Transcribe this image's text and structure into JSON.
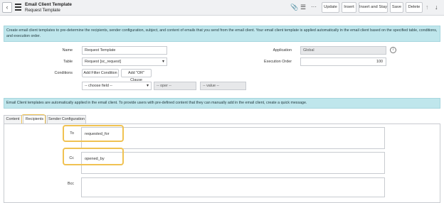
{
  "header": {
    "title": "Email Client Template",
    "subtitle": "Request Template",
    "buttons": {
      "update": "Update",
      "insert": "Insert",
      "insert_and_stay": "Insert and Stay",
      "save": "Save",
      "delete": "Delete"
    },
    "icons": [
      "back-icon",
      "menu-icon",
      "attachment-icon",
      "settings-icon",
      "more-icon",
      "arrow-up-icon",
      "arrow-down-icon"
    ]
  },
  "info_top": "Create email client templates to pre-determine the recipients, sender configuration, subject, and content of emails that you send from the email client. Your email client template is applied automatically in the email client based on the specified table, conditions, and execution order.",
  "form": {
    "name_label": "Name",
    "name_value": "Request Template",
    "table_label": "Table",
    "table_value": "Request [sc_request]",
    "conditions_label": "Conditions",
    "add_filter": "Add Filter Condition",
    "add_or": "Add \"OR\" Clause",
    "choose_field": "-- choose field --",
    "oper": "-- oper --",
    "value": "-- value --",
    "application_label": "Application",
    "application_value": "Global",
    "execution_order_label": "Execution Order",
    "execution_order_value": "100"
  },
  "info_bottom": "Email Client templates are automatically applied in the email client. To provide users with pre-defined content that they can manually add in the email client, create a quick message.",
  "tabs": [
    "Content",
    "Recipients",
    "Sender Configuration"
  ],
  "active_tab": "Recipients",
  "recipients": {
    "to_label": "To",
    "to_value": "requested_for",
    "cc_label": "Cc",
    "cc_value": "opened_by",
    "bcc_label": "Bcc",
    "bcc_value": ""
  },
  "colors": {
    "info_bar": "#bfe6ec",
    "highlight": "#f0c252"
  }
}
